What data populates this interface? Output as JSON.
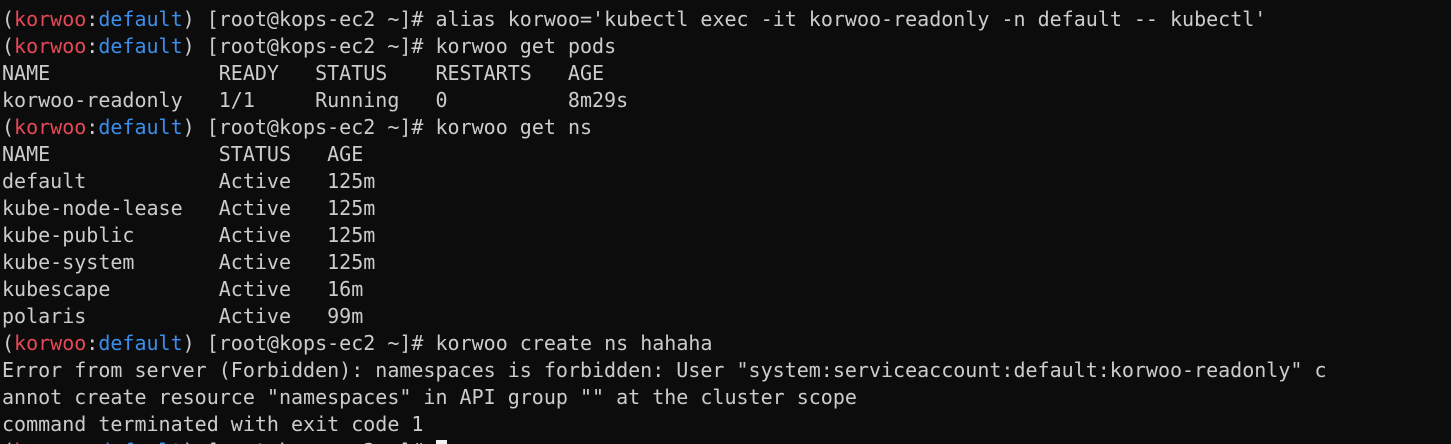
{
  "terminal": {
    "prompt": {
      "open": "(",
      "context": "korwoo",
      "sep": ":",
      "namespace": "default",
      "close": ")",
      "host": " [root@kops-ec2 ~]# "
    },
    "commands": {
      "alias": "alias korwoo='kubectl exec -it korwoo-readonly -n default -- kubectl'",
      "get_pods": "korwoo get pods",
      "get_ns": "korwoo get ns",
      "create_ns": "korwoo create ns hahaha"
    },
    "pods_output": {
      "header": "NAME              READY   STATUS    RESTARTS   AGE",
      "rows": [
        "korwoo-readonly   1/1     Running   0          8m29s"
      ]
    },
    "ns_output": {
      "header": "NAME              STATUS   AGE",
      "rows": [
        "default           Active   125m",
        "kube-node-lease   Active   125m",
        "kube-public       Active   125m",
        "kube-system       Active   125m",
        "kubescape         Active   16m",
        "polaris           Active   99m"
      ]
    },
    "error_output": [
      "Error from server (Forbidden): namespaces is forbidden: User \"system:serviceaccount:default:korwoo-readonly\" c",
      "annot create resource \"namespaces\" in API group \"\" at the cluster scope",
      "command terminated with exit code 1"
    ]
  }
}
